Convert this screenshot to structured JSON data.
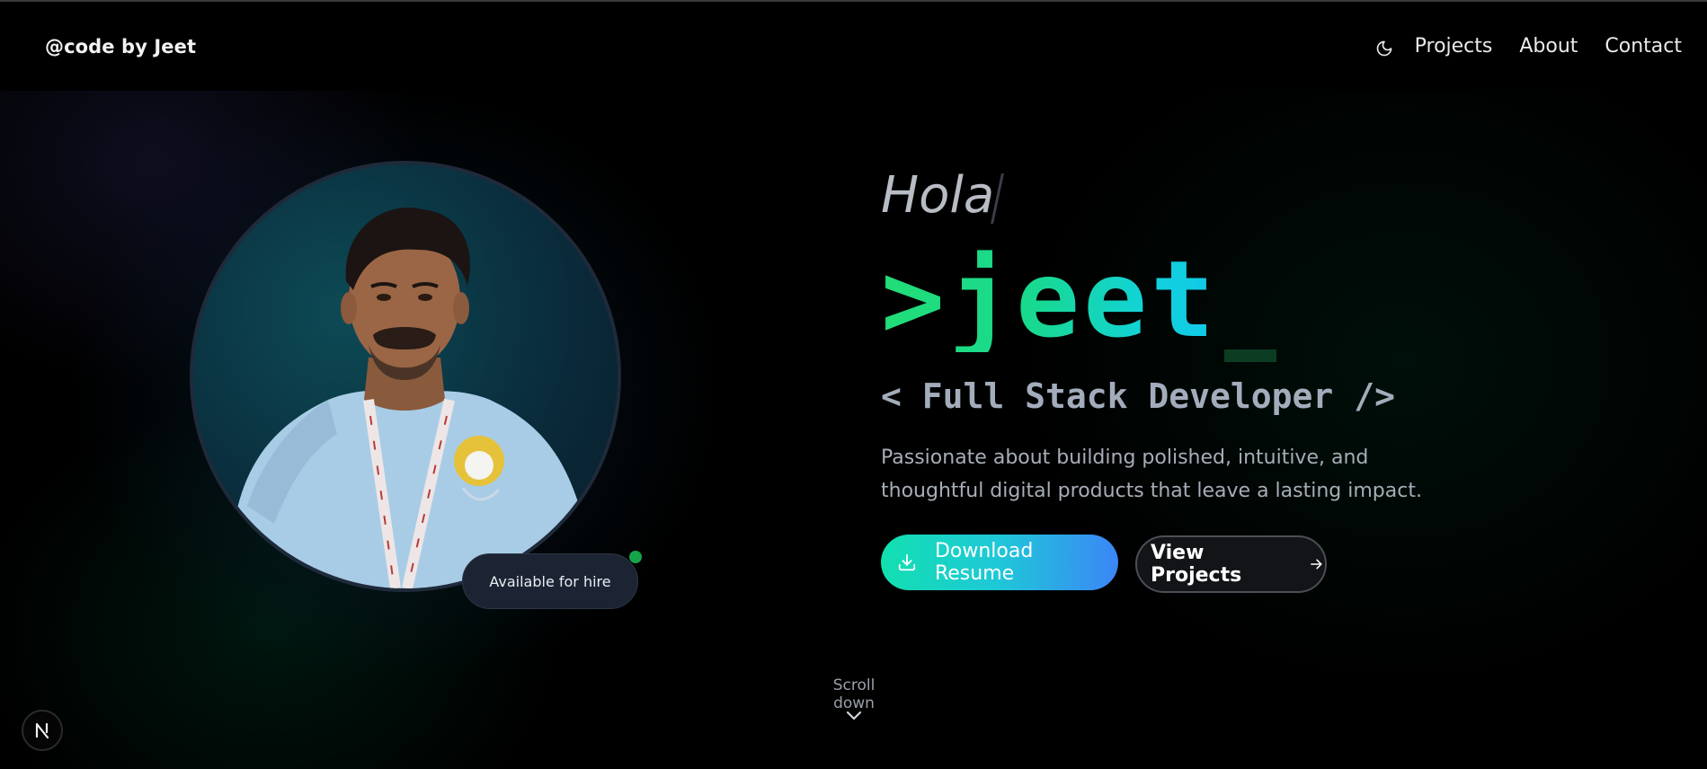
{
  "header": {
    "brand": "@code by Jeet",
    "theme_icon": "moon-icon",
    "nav": [
      {
        "label": "Projects"
      },
      {
        "label": "About"
      },
      {
        "label": "Contact"
      }
    ]
  },
  "hero": {
    "greeting": "Hola",
    "name": ">jeet",
    "role": "< Full Stack Developer />",
    "description": "Passionate about building polished, intuitive, and thoughtful digital products that leave a lasting impact.",
    "availability": "Available for hire",
    "download_button": {
      "label": "Download Resume",
      "icon": "download-icon"
    },
    "projects_button": {
      "label": "View Projects",
      "icon": "arrow-right-icon"
    },
    "scroll_label": "Scroll down",
    "scroll_icon": "chevron-down-icon"
  },
  "badge": {
    "label": "N"
  },
  "colors": {
    "background": "#000000",
    "name_gradient_start": "#22dd77",
    "name_gradient_end": "#10c8e8",
    "button_gradient_start": "#12e0b0",
    "button_gradient_end": "#3b86f7",
    "status_dot": "#16a34a"
  }
}
